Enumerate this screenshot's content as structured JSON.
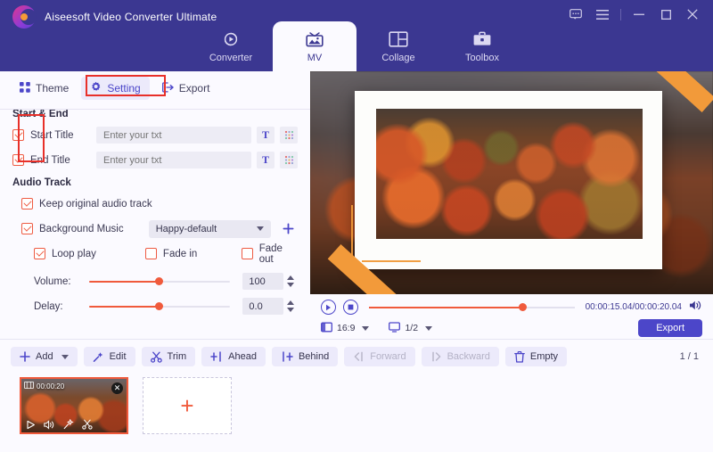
{
  "app": {
    "title": "Aiseesoft Video Converter Ultimate",
    "logo_icon": "aiseesoft-logo-icon"
  },
  "window_controls": {
    "feedback_label": "feedback-icon",
    "menu_label": "hamburger-menu-icon",
    "minimize_label": "minimize-icon",
    "maximize_label": "maximize-icon",
    "close_label": "close-icon"
  },
  "main_tabs": [
    {
      "label": "Converter",
      "icon": "converter-icon",
      "active": false
    },
    {
      "label": "MV",
      "icon": "mv-icon",
      "active": true
    },
    {
      "label": "Collage",
      "icon": "collage-icon",
      "active": false
    },
    {
      "label": "Toolbox",
      "icon": "toolbox-icon",
      "active": false
    }
  ],
  "sub_tabs": [
    {
      "label": "Theme",
      "icon": "grid-icon",
      "active": false
    },
    {
      "label": "Setting",
      "icon": "gear-icon",
      "active": true
    },
    {
      "label": "Export",
      "icon": "export-icon",
      "active": false
    }
  ],
  "start_end": {
    "heading": "Start & End",
    "start_title": {
      "checkbox_checked": true,
      "label": "Start Title",
      "value": "",
      "placeholder": "Enter your txt",
      "text_style_button": "T",
      "pattern_button": "pattern-grid-icon"
    },
    "end_title": {
      "checkbox_checked": true,
      "label": "End Title",
      "value": "",
      "placeholder": "Enter your txt",
      "text_style_button": "T",
      "pattern_button": "pattern-grid-icon"
    }
  },
  "audio_track": {
    "heading": "Audio Track",
    "keep_original": {
      "label": "Keep original audio track",
      "checked": true
    },
    "background_music": {
      "label": "Background Music",
      "checked": true,
      "selected_option": "Happy-default",
      "add_button": "+"
    },
    "loop_play": {
      "label": "Loop play",
      "checked": true
    },
    "fade_in": {
      "label": "Fade in",
      "checked": false
    },
    "fade_out": {
      "label": "Fade out",
      "checked": false
    },
    "volume": {
      "label": "Volume:",
      "value": "100",
      "percent": 50
    },
    "delay": {
      "label": "Delay:",
      "value": "0.0",
      "percent": 50
    }
  },
  "player": {
    "play_icon": "play-icon",
    "stop_icon": "stop-icon",
    "progress_percent": 75,
    "time_display": "00:00:15.04/00:00:20.04",
    "volume_icon": "volume-icon",
    "aspect_ratio": {
      "icon": "aspect-ratio-icon",
      "value": "16:9"
    },
    "scale": {
      "icon": "monitor-icon",
      "value": "1/2"
    },
    "export_button": "Export"
  },
  "toolbar": [
    {
      "label": "Add",
      "icon": "plus-icon",
      "has_caret": true,
      "disabled": false
    },
    {
      "label": "Edit",
      "icon": "magic-wand-icon",
      "has_caret": false,
      "disabled": false
    },
    {
      "label": "Trim",
      "icon": "scissors-icon",
      "has_caret": false,
      "disabled": false
    },
    {
      "label": "Ahead",
      "icon": "insert-ahead-icon",
      "has_caret": false,
      "disabled": false
    },
    {
      "label": "Behind",
      "icon": "insert-behind-icon",
      "has_caret": false,
      "disabled": false
    },
    {
      "label": "Forward",
      "icon": "move-forward-icon",
      "has_caret": false,
      "disabled": true
    },
    {
      "label": "Backward",
      "icon": "move-backward-icon",
      "has_caret": false,
      "disabled": true
    },
    {
      "label": "Empty",
      "icon": "trash-icon",
      "has_caret": false,
      "disabled": false
    }
  ],
  "page_indicator": "1 / 1",
  "media_strip": {
    "clip": {
      "duration": "00:00:20",
      "duration_icon": "film-icon",
      "close_icon": "close-icon",
      "tools": [
        "play-icon",
        "volume-icon",
        "effects-icon",
        "scissors-icon"
      ]
    },
    "add_card": {
      "label": "+",
      "icon": "plus-icon"
    }
  },
  "annotations": {
    "setting_tab_highlight": true,
    "title_checkbox_highlight": true,
    "highlight_color": "#e8302a"
  },
  "colors": {
    "header_purple": "#3b3791",
    "accent_indigo": "#4c46c9",
    "accent_orange": "#f05a3c",
    "panel_bg": "#fbfaff",
    "tape_orange": "#f29a3a"
  }
}
